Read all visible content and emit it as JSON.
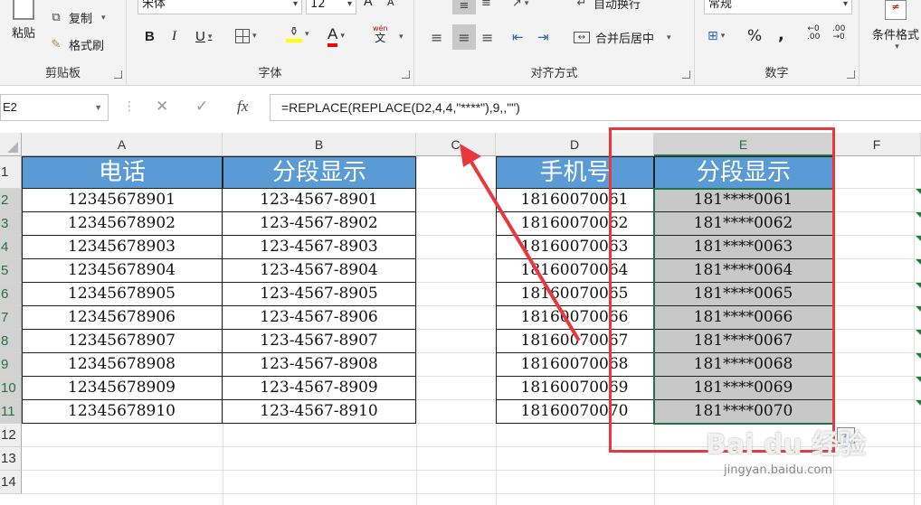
{
  "ribbon": {
    "clipboard": {
      "paste_label": "粘贴",
      "copy_label": "复制",
      "format_painter_label": "格式刷",
      "group_label": "剪贴板"
    },
    "font": {
      "font_name": "宋体",
      "font_size": "12",
      "group_label": "字体",
      "bold": "B",
      "italic": "I",
      "underline": "U",
      "font_color": "A",
      "phonetic_top": "wén",
      "phonetic_bottom": "文",
      "grow": "A",
      "shrink": "A"
    },
    "alignment": {
      "wrap_text_label": "自动换行",
      "merge_center_label": "合并后居中",
      "group_label": "对齐方式"
    },
    "number": {
      "format_value": "常规",
      "percent": "%",
      "comma": ",",
      "inc_decimal_top": "←0",
      "inc_decimal_bottom": ".00",
      "dec_decimal_top": ".00",
      "dec_decimal_bottom": "→0",
      "group_label": "数字"
    },
    "styles": {
      "conditional_format_label": "条件格式"
    }
  },
  "formula_bar": {
    "name_box": "E2",
    "cancel": "✕",
    "enter": "✓",
    "fx": "fx",
    "formula": "=REPLACE(REPLACE(D2,4,4,\"****\"),9,,\"\")"
  },
  "sheet": {
    "columns": [
      "A",
      "B",
      "C",
      "D",
      "E",
      "F"
    ],
    "rows": [
      "1",
      "2",
      "3",
      "4",
      "5",
      "6",
      "7",
      "8",
      "9",
      "10",
      "11",
      "12",
      "13",
      "14"
    ],
    "header_row": {
      "A": "电话",
      "B": "分段显示",
      "D": "手机号",
      "E": "分段显示"
    },
    "phones": [
      "12345678901",
      "12345678902",
      "12345678903",
      "12345678904",
      "12345678905",
      "12345678906",
      "12345678907",
      "12345678908",
      "12345678909",
      "12345678910"
    ],
    "segmented": [
      "123-4567-8901",
      "123-4567-8902",
      "123-4567-8903",
      "123-4567-8904",
      "123-4567-8905",
      "123-4567-8906",
      "123-4567-8907",
      "123-4567-8908",
      "123-4567-8909",
      "123-4567-8910"
    ],
    "mobiles": [
      "18160070061",
      "18160070062",
      "18160070063",
      "18160070064",
      "18160070065",
      "18160070066",
      "18160070067",
      "18160070068",
      "18160070069",
      "18160070070"
    ],
    "masked": [
      "181****0061",
      "181****0062",
      "181****0063",
      "181****0064",
      "181****0065",
      "181****0066",
      "181****0067",
      "181****0068",
      "181****0069",
      "181****0070"
    ]
  },
  "colors": {
    "header_fill": "#5b9bd5",
    "selection_fill": "#c8c8c8",
    "annotation_red": "#e8383d",
    "excel_green": "#217346"
  },
  "watermark": {
    "brand": "Bai du 经验",
    "url": "jingyan.baidu.com"
  }
}
